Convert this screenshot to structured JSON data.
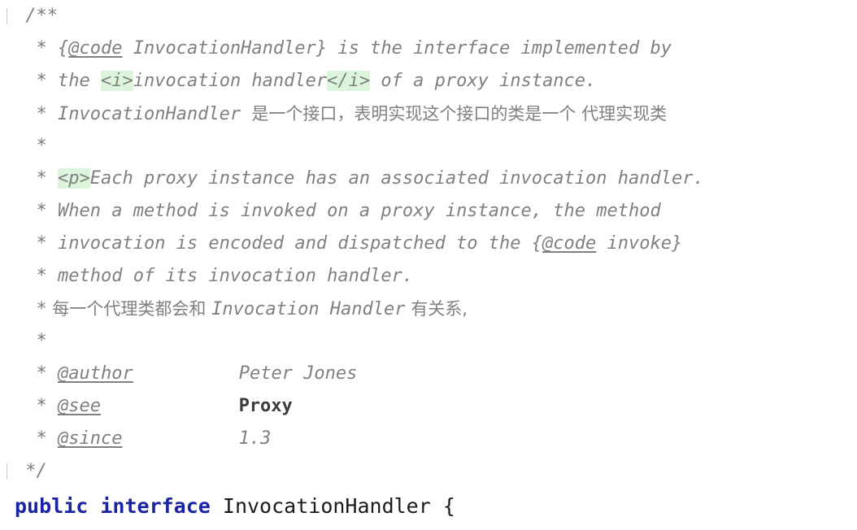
{
  "editor": {
    "language": "java",
    "background_color": "#ffffff",
    "comment_color": "#808080",
    "keyword_color": "#1a23a0",
    "identifier_color": "#1a1a1a",
    "html_tag_highlight_color": "#dcf5dc"
  },
  "lines": [
    {
      "id": "line-1",
      "type": "comment-open",
      "fold_tick": true,
      "text": "/**"
    },
    {
      "id": "line-2",
      "type": "comment",
      "star": "*",
      "segments": [
        {
          "kind": "text",
          "text": " {"
        },
        {
          "kind": "javadoc-tag",
          "text": "@code"
        },
        {
          "kind": "text",
          "text": " InvocationHandler} is the interface implemented by"
        }
      ]
    },
    {
      "id": "line-3",
      "type": "comment",
      "star": "*",
      "segments": [
        {
          "kind": "text",
          "text": " the "
        },
        {
          "kind": "html-tag",
          "text": "<i>"
        },
        {
          "kind": "text",
          "text": "invocation handler"
        },
        {
          "kind": "html-tag",
          "text": "</i>"
        },
        {
          "kind": "text",
          "text": " of a proxy instance."
        }
      ]
    },
    {
      "id": "line-4",
      "type": "comment",
      "star": "*",
      "segments": [
        {
          "kind": "text",
          "text": " InvocationHandler "
        },
        {
          "kind": "cjk",
          "text": "是一个接口，表明实现这个接口的类是一个 代理实现类"
        }
      ]
    },
    {
      "id": "line-5",
      "type": "comment",
      "star": "*",
      "segments": []
    },
    {
      "id": "line-6",
      "type": "comment",
      "star": "*",
      "segments": [
        {
          "kind": "text",
          "text": " "
        },
        {
          "kind": "html-tag",
          "text": "<p>"
        },
        {
          "kind": "text",
          "text": "Each proxy instance has an associated invocation handler."
        }
      ]
    },
    {
      "id": "line-7",
      "type": "comment",
      "star": "*",
      "segments": [
        {
          "kind": "text",
          "text": " When a method is invoked on a proxy instance, the method"
        }
      ]
    },
    {
      "id": "line-8",
      "type": "comment",
      "star": "*",
      "segments": [
        {
          "kind": "text",
          "text": " invocation is encoded and dispatched to the {"
        },
        {
          "kind": "javadoc-tag",
          "text": "@code"
        },
        {
          "kind": "text",
          "text": " invoke}"
        }
      ]
    },
    {
      "id": "line-9",
      "type": "comment",
      "star": "*",
      "segments": [
        {
          "kind": "text",
          "text": " method of its invocation handler."
        }
      ]
    },
    {
      "id": "line-10",
      "type": "comment",
      "star": "*",
      "segments": [
        {
          "kind": "cjk",
          "text": " 每一个代理类都会和 "
        },
        {
          "kind": "text",
          "text": "Invocation Handler"
        },
        {
          "kind": "cjk",
          "text": " 有关系,"
        }
      ]
    },
    {
      "id": "line-11",
      "type": "comment",
      "star": "*",
      "segments": []
    },
    {
      "id": "line-12",
      "type": "comment-blocktag",
      "star": "*",
      "tag": "@author",
      "value": "Peter Jones",
      "value_bold": false
    },
    {
      "id": "line-13",
      "type": "comment-blocktag",
      "star": "*",
      "tag": "@see",
      "value": "Proxy",
      "value_bold": true
    },
    {
      "id": "line-14",
      "type": "comment-blocktag",
      "star": "*",
      "tag": "@since",
      "value": "1.3",
      "value_bold": false
    },
    {
      "id": "line-15",
      "type": "comment-close",
      "fold_tick": true,
      "text": "*/"
    }
  ],
  "declaration": {
    "id": "line-16",
    "keyword_1": "public",
    "keyword_2": "interface",
    "type_name": "InvocationHandler",
    "brace": "{"
  }
}
